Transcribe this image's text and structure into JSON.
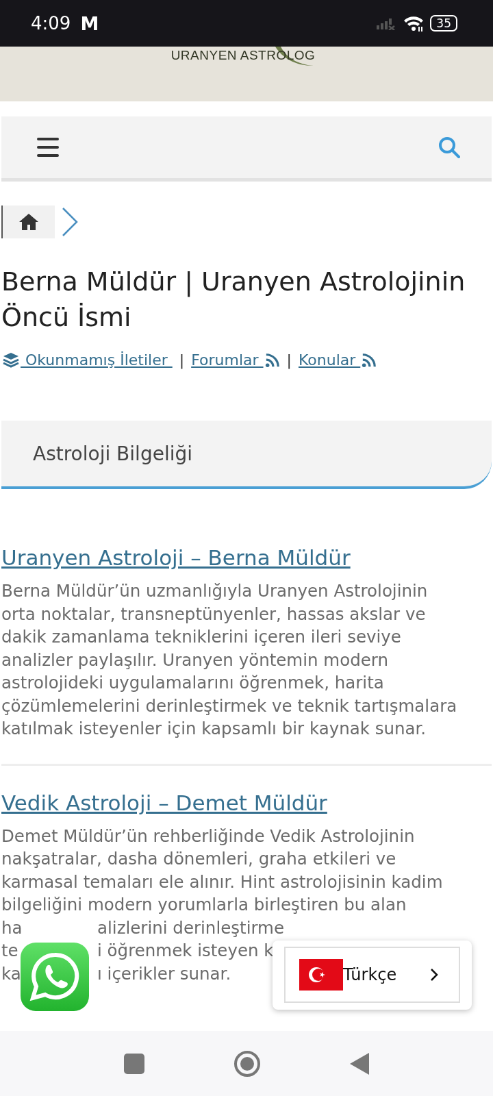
{
  "status_bar": {
    "time": "4:09",
    "notification": "M",
    "battery": "35"
  },
  "header": {
    "logo_text": "URANYEN ASTROLOG"
  },
  "title": "Berna Müldür | Uranyen Astrolojinin Öncü İsmi",
  "links": [
    {
      "kind": "link",
      "label": " Okunmamış İletiler "
    },
    {
      "kind": "separator",
      "label": "|"
    },
    {
      "kind": "link",
      "label": "Forumlar "
    },
    {
      "kind": "separator",
      "label": "|"
    },
    {
      "kind": "link",
      "label": "Konular "
    }
  ],
  "section_heading": "Astroloji Bilgeliği",
  "posts": [
    {
      "title": "Uranyen Astroloji – Berna Müldür",
      "lines": [
        {
          "segments": [
            "Berna Müldür’ün uzmanlığıyla Uranyen Astrolojinin"
          ]
        },
        {
          "segments": [
            "orta noktalar, transneptünyenler, hassas akslar ve"
          ]
        },
        {
          "segments": [
            "dakik zamanlama tekniklerini içeren ileri seviye"
          ]
        },
        {
          "segments": [
            "analizler paylaşılır. Uranyen yöntemin modern"
          ]
        },
        {
          "segments": [
            "astrolojideki uygulamalarını öğrenmek, harita"
          ]
        },
        {
          "segments": [
            "çözümlemelerini derinleştirmek ve teknik tartışmalara"
          ]
        },
        {
          "segments": [
            "katılmak isteyenler için kapsamlı bir kaynak sunar."
          ]
        }
      ]
    },
    {
      "title": "Vedik Astroloji – Demet Müldür",
      "lines": [
        {
          "segments": [
            "Demet Müldür’ün rehberliğinde Vedik Astrolojinin"
          ]
        },
        {
          "segments": [
            "nakşatralar, dasha dönemleri, graha etkileri ve"
          ]
        },
        {
          "segments": [
            "karmasal temaları ele alınır. Hint astrolojisinin kadim"
          ]
        },
        {
          "segments": [
            "bilgeliğini modern yorumlarla birleştiren bu alan"
          ]
        },
        {
          "segments": [
            "ha",
            "alizlerini derinleştirme"
          ]
        },
        {
          "segments": [
            "te",
            "i öğrenmek isteyen k"
          ]
        },
        {
          "segments": [
            "ka",
            "ı içerikler sunar."
          ]
        }
      ]
    }
  ],
  "language_selector": {
    "label": "Türkçe"
  }
}
